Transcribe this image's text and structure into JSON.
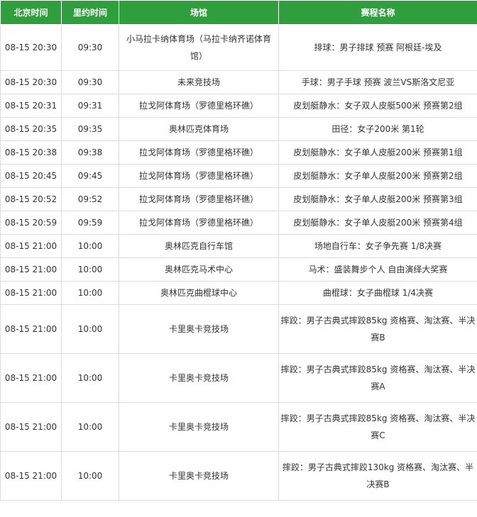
{
  "headers": {
    "beijing_time": "北京时间",
    "rio_time": "里约时间",
    "venue": "场馆",
    "event": "赛程名称"
  },
  "rows": [
    {
      "beijing": "08-15 20:30",
      "rio": "09:30",
      "venue": "小马拉卡纳体育场（马拉卡纳齐诺体育馆）",
      "event": "排球：男子排球 预赛 阿根廷-埃及"
    },
    {
      "beijing": "08-15 20:30",
      "rio": "09:30",
      "venue": "未来竞技场",
      "event": "手球：男子手球 预赛 波兰VS斯洛文尼亚"
    },
    {
      "beijing": "08-15 20:31",
      "rio": "09:31",
      "venue": "拉戈阿体育场（罗德里格环礁）",
      "event": "皮划艇静水：女子双人皮艇500米 预赛第2组"
    },
    {
      "beijing": "08-15 20:35",
      "rio": "09:35",
      "venue": "奥林匹克体育场",
      "event": "田径：女子200米 第1轮"
    },
    {
      "beijing": "08-15 20:38",
      "rio": "09:38",
      "venue": "拉戈阿体育场（罗德里格环礁）",
      "event": "皮划艇静水：女子单人皮艇200米 预赛第1组"
    },
    {
      "beijing": "08-15 20:45",
      "rio": "09:45",
      "venue": "拉戈阿体育场（罗德里格环礁）",
      "event": "皮划艇静水：女子单人皮艇200米 预赛第2组"
    },
    {
      "beijing": "08-15 20:52",
      "rio": "09:52",
      "venue": "拉戈阿体育场（罗德里格环礁）",
      "event": "皮划艇静水：女子单人皮艇200米 预赛第3组"
    },
    {
      "beijing": "08-15 20:59",
      "rio": "09:59",
      "venue": "拉戈阿体育场（罗德里格环礁）",
      "event": "皮划艇静水：女子单人皮艇200米 预赛第4组"
    },
    {
      "beijing": "08-15 21:00",
      "rio": "10:00",
      "venue": "奥林匹克自行车馆",
      "event": "场地自行车：女子争先赛 1/8决赛"
    },
    {
      "beijing": "08-15 21:00",
      "rio": "10:00",
      "venue": "奥林匹克马术中心",
      "event": "马术：盛装舞步个人 自由演绎大奖赛"
    },
    {
      "beijing": "08-15 21:00",
      "rio": "10:00",
      "venue": "奥林匹克曲棍球中心",
      "event": "曲棍球：女子曲棍球 1/4决赛"
    },
    {
      "beijing": "08-15 21:00",
      "rio": "10:00",
      "venue": "卡里奥卡竞技场",
      "event": "摔跤：男子古典式摔跤85kg 资格赛、淘汰赛、半决赛B"
    },
    {
      "beijing": "08-15 21:00",
      "rio": "10:00",
      "venue": "卡里奥卡竞技场",
      "event": "摔跤：男子古典式摔跤85kg 资格赛、淘汰赛、半决赛A"
    },
    {
      "beijing": "08-15 21:00",
      "rio": "10:00",
      "venue": "卡里奥卡竞技场",
      "event": "摔跤：男子古典式摔跤85kg 资格赛、淘汰赛、半决赛C"
    },
    {
      "beijing": "08-15 21:00",
      "rio": "10:00",
      "venue": "卡里奥卡竞技场",
      "event": "摔跤：男子古典式摔跤130kg 资格赛、淘汰赛、半决赛B"
    }
  ]
}
